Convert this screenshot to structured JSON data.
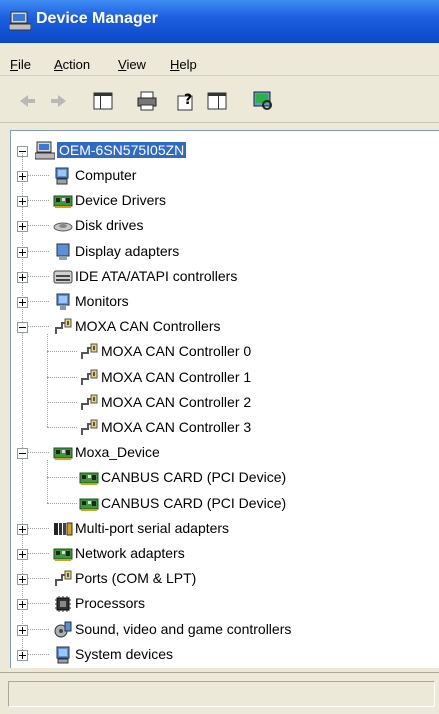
{
  "window": {
    "title": "Device Manager"
  },
  "menu": [
    {
      "label": "File",
      "key": "F",
      "rest": "ile"
    },
    {
      "label": "Action",
      "key": "A",
      "rest": "ction"
    },
    {
      "label": "View",
      "key": "V",
      "rest": "iew"
    },
    {
      "label": "Help",
      "key": "H",
      "rest": "elp"
    }
  ],
  "toolbar": {
    "buttons": [
      "back-icon",
      "forward-icon",
      "show-hide-tree-icon",
      "print-icon",
      "help-icon",
      "properties-icon",
      "scan-hardware-icon"
    ]
  },
  "tree": {
    "root": "OEM-6SN575I05ZN",
    "nodes": [
      {
        "label": "Computer",
        "icon": "computer-icon",
        "level": 1,
        "state": "collapsed"
      },
      {
        "label": "Device Drivers",
        "icon": "board-icon",
        "level": 1,
        "state": "collapsed"
      },
      {
        "label": "Disk drives",
        "icon": "disk-icon",
        "level": 1,
        "state": "collapsed"
      },
      {
        "label": "Display adapters",
        "icon": "display-icon",
        "level": 1,
        "state": "collapsed"
      },
      {
        "label": "IDE ATA/ATAPI controllers",
        "icon": "ide-icon",
        "level": 1,
        "state": "collapsed"
      },
      {
        "label": "Monitors",
        "icon": "monitor-icon",
        "level": 1,
        "state": "collapsed"
      },
      {
        "label": "MOXA CAN Controllers",
        "icon": "port-icon",
        "level": 1,
        "state": "expanded"
      },
      {
        "label": "MOXA CAN Controller 0",
        "icon": "port-icon",
        "level": 2
      },
      {
        "label": "MOXA CAN Controller 1",
        "icon": "port-icon",
        "level": 2
      },
      {
        "label": "MOXA CAN Controller 2",
        "icon": "port-icon",
        "level": 2
      },
      {
        "label": "MOXA CAN Controller 3",
        "icon": "port-icon",
        "level": 2
      },
      {
        "label": "Moxa_Device",
        "icon": "board-icon",
        "level": 1,
        "state": "expanded"
      },
      {
        "label": "CANBUS CARD (PCI Device)",
        "icon": "board-icon",
        "level": 2
      },
      {
        "label": "CANBUS CARD (PCI Device)",
        "icon": "board-icon",
        "level": 2
      },
      {
        "label": "Multi-port serial adapters",
        "icon": "serial-icon",
        "level": 1,
        "state": "collapsed"
      },
      {
        "label": "Network adapters",
        "icon": "board-icon",
        "level": 1,
        "state": "collapsed"
      },
      {
        "label": "Ports (COM & LPT)",
        "icon": "port-icon",
        "level": 1,
        "state": "collapsed"
      },
      {
        "label": "Processors",
        "icon": "processor-icon",
        "level": 1,
        "state": "collapsed"
      },
      {
        "label": "Sound, video and game controllers",
        "icon": "sound-icon",
        "level": 1,
        "state": "collapsed"
      },
      {
        "label": "System devices",
        "icon": "system-icon",
        "level": 1,
        "state": "collapsed"
      }
    ]
  },
  "colors": {
    "titlebar": "#0a49c7",
    "selection": "#316ac5",
    "chrome": "#ece9d8"
  }
}
